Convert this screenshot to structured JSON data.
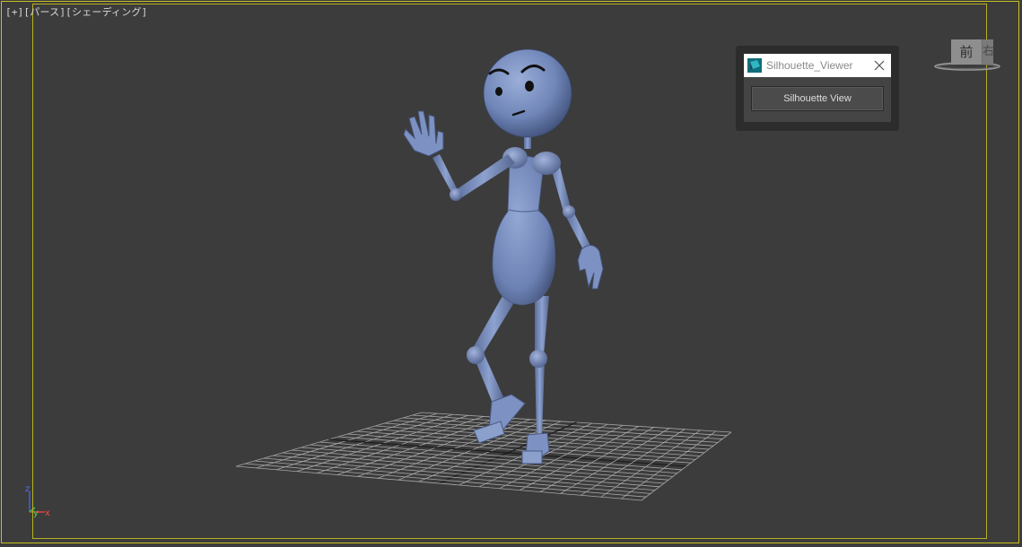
{
  "viewport": {
    "label_plus": "[+]",
    "label_view": "[パース]",
    "label_shading": "[シェーディング]"
  },
  "dialog": {
    "title": "Silhouette_Viewer",
    "button_label": "Silhouette View"
  },
  "viewcube": {
    "face_label": "前",
    "side_label": "右"
  },
  "axis_gizmo": {
    "z": "z",
    "y": "y",
    "x": "x"
  },
  "colors": {
    "background": "#3c3c3c",
    "frame": "#c8c020",
    "character": "#7a90c0",
    "grid": "#a8a8a8",
    "axis_x": "#e04040",
    "axis_y": "#40c040",
    "axis_z": "#4060e0"
  }
}
